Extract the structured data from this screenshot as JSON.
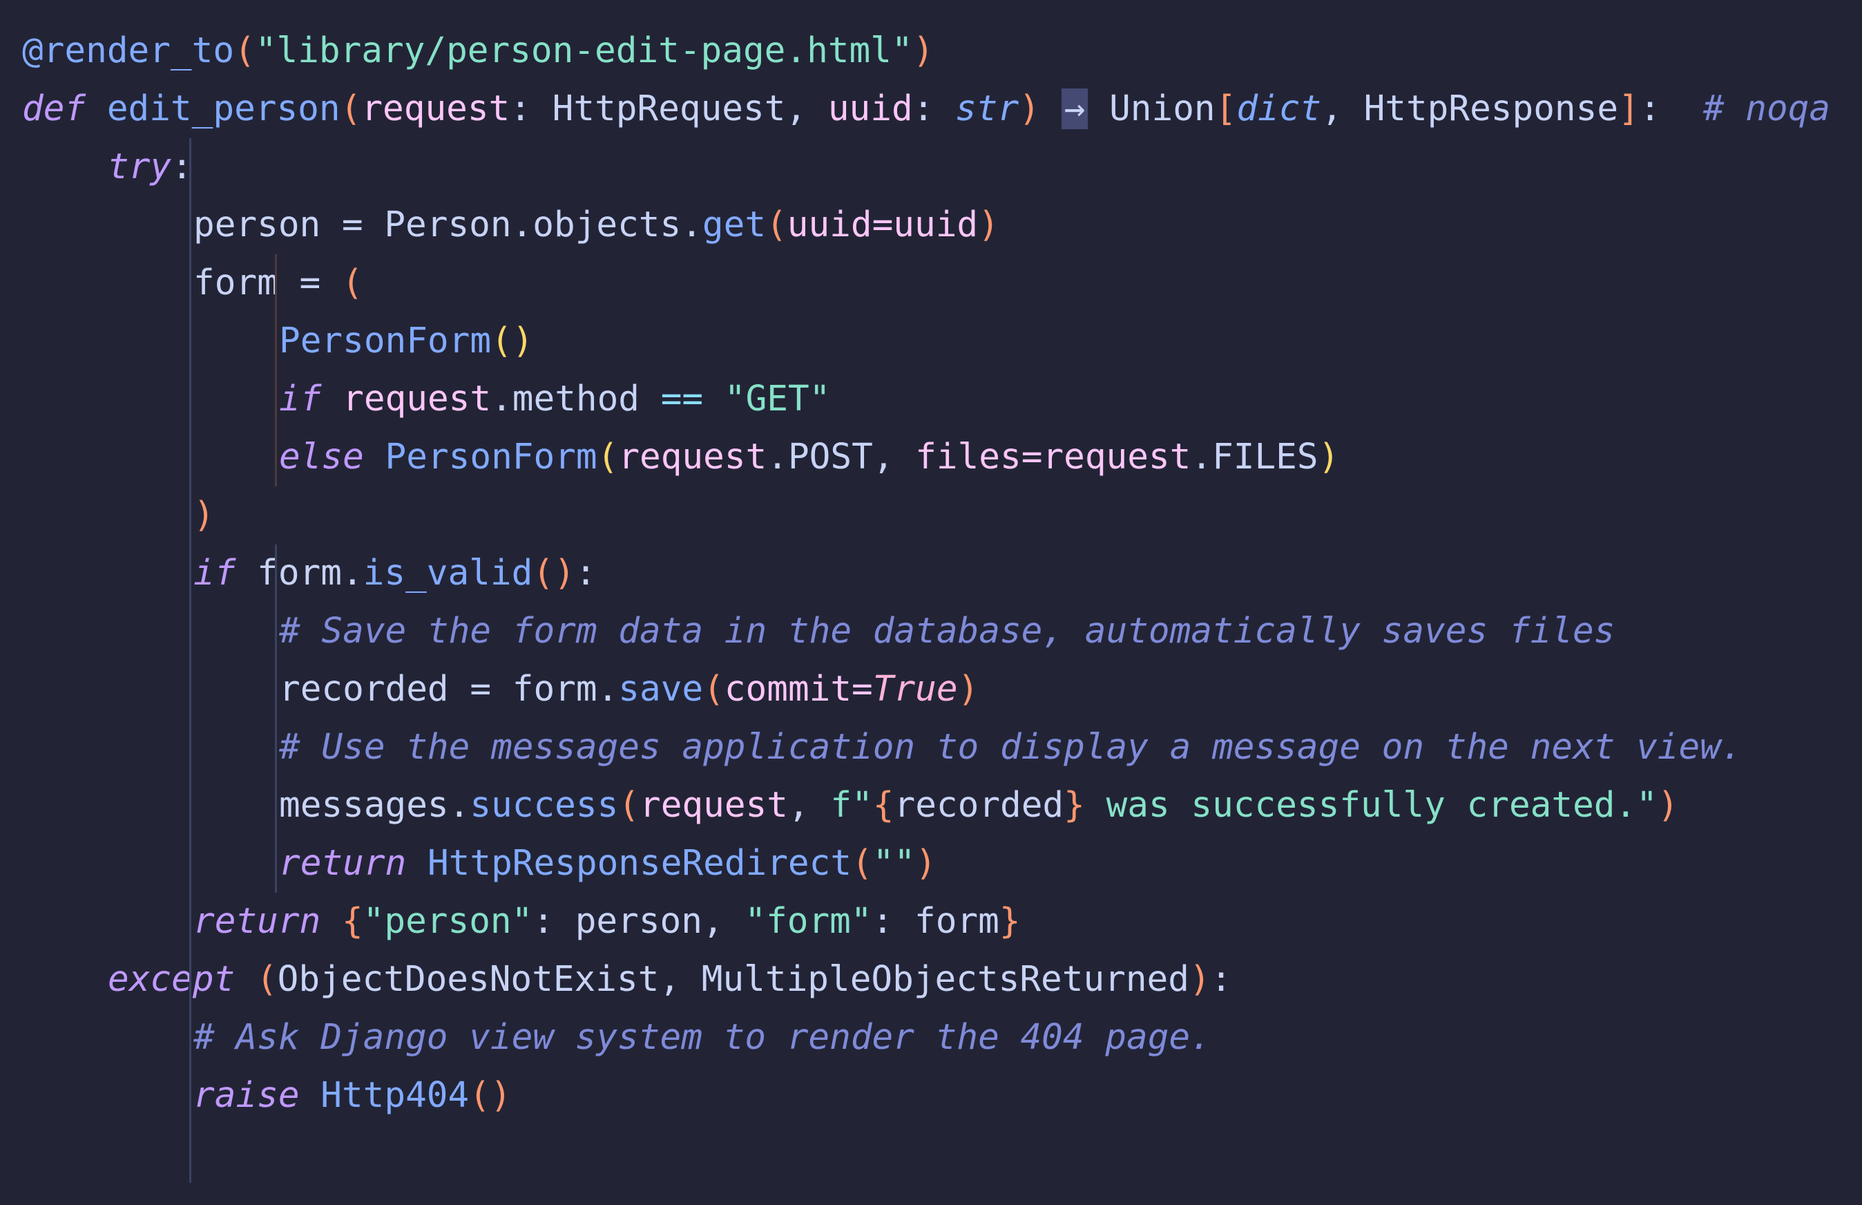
{
  "code_lines": [
    {
      "indent": 0,
      "tokens": [
        {
          "t": "@render_to",
          "c": "decorator"
        },
        {
          "t": "(",
          "c": "paren"
        },
        {
          "t": "\"library/person-edit-page.html\"",
          "c": "string"
        },
        {
          "t": ")",
          "c": "paren"
        }
      ]
    },
    {
      "indent": 0,
      "tokens": [
        {
          "t": "def",
          "c": "keyword"
        },
        {
          "t": " ",
          "c": "plain"
        },
        {
          "t": "edit_person",
          "c": "func"
        },
        {
          "t": "(",
          "c": "paren"
        },
        {
          "t": "request",
          "c": "param"
        },
        {
          "t": ": HttpRequest, ",
          "c": "plain"
        },
        {
          "t": "uuid",
          "c": "param"
        },
        {
          "t": ": ",
          "c": "plain"
        },
        {
          "t": "str",
          "c": "type-italic"
        },
        {
          "t": ")",
          "c": "paren"
        },
        {
          "t": " ",
          "c": "plain"
        },
        {
          "t": "→",
          "c": "arrow"
        },
        {
          "t": " Union",
          "c": "plain"
        },
        {
          "t": "[",
          "c": "paren"
        },
        {
          "t": "dict",
          "c": "type-italic"
        },
        {
          "t": ", HttpResponse",
          "c": "plain"
        },
        {
          "t": "]",
          "c": "paren"
        },
        {
          "t": ":  ",
          "c": "plain"
        },
        {
          "t": "# noqa",
          "c": "comment"
        }
      ]
    },
    {
      "indent": 1,
      "tokens": [
        {
          "t": "try",
          "c": "keyword"
        },
        {
          "t": ":",
          "c": "plain"
        }
      ]
    },
    {
      "indent": 2,
      "tokens": [
        {
          "t": "person = Person.objects.",
          "c": "plain"
        },
        {
          "t": "get",
          "c": "func"
        },
        {
          "t": "(",
          "c": "paren"
        },
        {
          "t": "uuid=uuid",
          "c": "param"
        },
        {
          "t": ")",
          "c": "paren"
        }
      ]
    },
    {
      "indent": 2,
      "tokens": [
        {
          "t": "form = ",
          "c": "plain"
        },
        {
          "t": "(",
          "c": "paren"
        }
      ]
    },
    {
      "indent": 3,
      "tokens": [
        {
          "t": "PersonForm",
          "c": "func"
        },
        {
          "t": "()",
          "c": "paren2"
        }
      ]
    },
    {
      "indent": 3,
      "tokens": [
        {
          "t": "if",
          "c": "keyword"
        },
        {
          "t": " ",
          "c": "plain"
        },
        {
          "t": "request",
          "c": "param"
        },
        {
          "t": ".method ",
          "c": "plain"
        },
        {
          "t": "==",
          "c": "op"
        },
        {
          "t": " ",
          "c": "plain"
        },
        {
          "t": "\"GET\"",
          "c": "string"
        }
      ]
    },
    {
      "indent": 3,
      "tokens": [
        {
          "t": "else",
          "c": "keyword"
        },
        {
          "t": " ",
          "c": "plain"
        },
        {
          "t": "PersonForm",
          "c": "func"
        },
        {
          "t": "(",
          "c": "paren2"
        },
        {
          "t": "request",
          "c": "param"
        },
        {
          "t": ".POST, ",
          "c": "plain"
        },
        {
          "t": "files=request",
          "c": "param"
        },
        {
          "t": ".FILES",
          "c": "plain"
        },
        {
          "t": ")",
          "c": "paren2"
        }
      ]
    },
    {
      "indent": 2,
      "tokens": [
        {
          "t": ")",
          "c": "paren"
        }
      ]
    },
    {
      "indent": 2,
      "tokens": [
        {
          "t": "if",
          "c": "keyword"
        },
        {
          "t": " form.",
          "c": "plain"
        },
        {
          "t": "is_valid",
          "c": "func"
        },
        {
          "t": "()",
          "c": "paren"
        },
        {
          "t": ":",
          "c": "plain"
        }
      ]
    },
    {
      "indent": 3,
      "tokens": [
        {
          "t": "# Save the form data in the database, automatically saves files",
          "c": "comment"
        }
      ]
    },
    {
      "indent": 3,
      "tokens": [
        {
          "t": "recorded = form.",
          "c": "plain"
        },
        {
          "t": "save",
          "c": "func"
        },
        {
          "t": "(",
          "c": "paren"
        },
        {
          "t": "commit=",
          "c": "param"
        },
        {
          "t": "True",
          "c": "const"
        },
        {
          "t": ")",
          "c": "paren"
        }
      ]
    },
    {
      "indent": 3,
      "tokens": [
        {
          "t": "# Use the messages application to display a message on the next view.",
          "c": "comment"
        }
      ]
    },
    {
      "indent": 3,
      "tokens": [
        {
          "t": "messages.",
          "c": "plain"
        },
        {
          "t": "success",
          "c": "func"
        },
        {
          "t": "(",
          "c": "paren"
        },
        {
          "t": "request",
          "c": "param"
        },
        {
          "t": ", ",
          "c": "plain"
        },
        {
          "t": "f\"",
          "c": "string"
        },
        {
          "t": "{",
          "c": "fstring"
        },
        {
          "t": "recorded",
          "c": "plain"
        },
        {
          "t": "}",
          "c": "fstring"
        },
        {
          "t": " was successfully created.\"",
          "c": "string"
        },
        {
          "t": ")",
          "c": "paren"
        }
      ]
    },
    {
      "indent": 3,
      "tokens": [
        {
          "t": "return",
          "c": "keyword"
        },
        {
          "t": " ",
          "c": "plain"
        },
        {
          "t": "HttpResponseRedirect",
          "c": "func"
        },
        {
          "t": "(",
          "c": "paren"
        },
        {
          "t": "\"\"",
          "c": "string"
        },
        {
          "t": ")",
          "c": "paren"
        }
      ]
    },
    {
      "indent": 2,
      "tokens": [
        {
          "t": "return",
          "c": "keyword"
        },
        {
          "t": " ",
          "c": "plain"
        },
        {
          "t": "{",
          "c": "paren"
        },
        {
          "t": "\"person\"",
          "c": "string"
        },
        {
          "t": ": person, ",
          "c": "plain"
        },
        {
          "t": "\"form\"",
          "c": "string"
        },
        {
          "t": ": form",
          "c": "plain"
        },
        {
          "t": "}",
          "c": "paren"
        }
      ]
    },
    {
      "indent": 1,
      "tokens": [
        {
          "t": "except",
          "c": "keyword"
        },
        {
          "t": " ",
          "c": "plain"
        },
        {
          "t": "(",
          "c": "paren"
        },
        {
          "t": "ObjectDoesNotExist, MultipleObjectsReturned",
          "c": "plain"
        },
        {
          "t": ")",
          "c": "paren"
        },
        {
          "t": ":",
          "c": "plain"
        }
      ]
    },
    {
      "indent": 2,
      "tokens": [
        {
          "t": "# Ask Django view system to render the 404 page.",
          "c": "comment"
        }
      ]
    },
    {
      "indent": 2,
      "tokens": [
        {
          "t": "raise",
          "c": "keyword"
        },
        {
          "t": " ",
          "c": "plain"
        },
        {
          "t": "Http404",
          "c": "func"
        },
        {
          "t": "()",
          "c": "paren"
        }
      ]
    }
  ],
  "indent_guides": [
    {
      "level": 1,
      "from_line": 3,
      "to_line": 16,
      "color": "#3b4261"
    },
    {
      "level": 2,
      "from_line": 5,
      "to_line": 8,
      "color": "#4f3a3a"
    },
    {
      "level": 2,
      "from_line": 10,
      "to_line": 15,
      "color": "#3b4261"
    },
    {
      "level": 1,
      "from_line": 17,
      "to_line": 20,
      "color": "#3b4261"
    }
  ]
}
